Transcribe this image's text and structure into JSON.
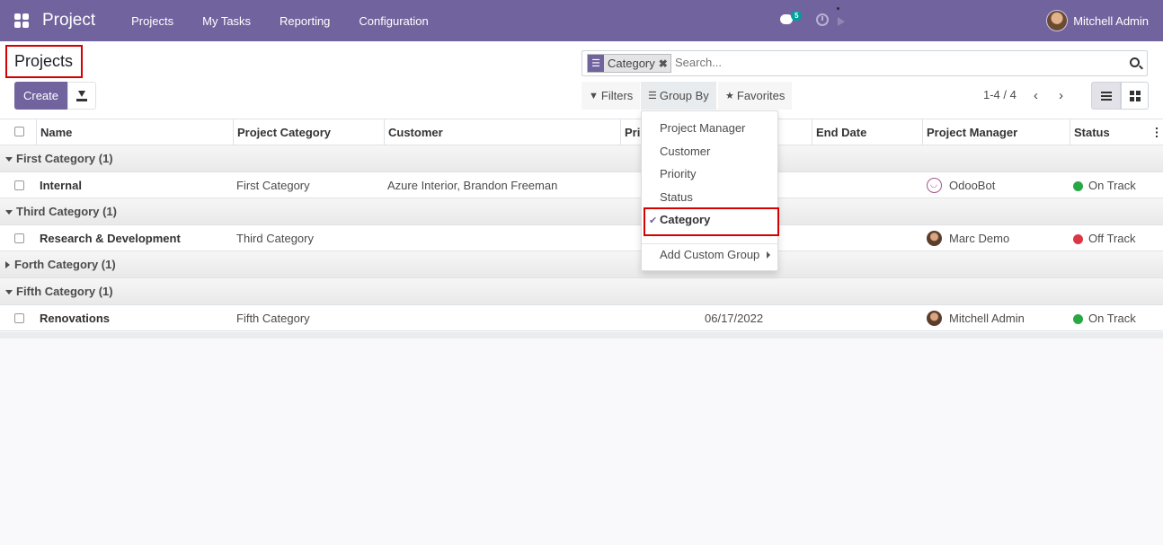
{
  "navbar": {
    "app_title": "Project",
    "menu": [
      "Projects",
      "My Tasks",
      "Reporting",
      "Configuration"
    ],
    "chat_badge": "5",
    "user_name": "Mitchell Admin"
  },
  "control": {
    "breadcrumb_title": "Projects",
    "create_label": "Create",
    "search": {
      "facet_label": "Category",
      "placeholder": "Search..."
    },
    "filters_label": "Filters",
    "groupby_label": "Group By",
    "favorites_label": "Favorites",
    "pager": "1-4 / 4"
  },
  "table": {
    "headers": [
      "Name",
      "Project Category",
      "Customer",
      "Pri",
      "End Date",
      "Project Manager",
      "Status"
    ],
    "groups": [
      {
        "label": "First Category (1)",
        "expanded": true
      },
      {
        "label": "Third Category (1)",
        "expanded": true
      },
      {
        "label": "Forth Category (1)",
        "expanded": false
      },
      {
        "label": "Fifth Category (1)",
        "expanded": true
      }
    ],
    "rows": [
      {
        "name": "Internal",
        "category": "First Category",
        "customer": "Azure Interior, Brandon Freeman",
        "date": "",
        "manager": "OdooBot",
        "status": "On Track",
        "status_color": "#28a745"
      },
      {
        "name": "Research & Development",
        "category": "Third Category",
        "customer": "",
        "date": "",
        "manager": "Marc Demo",
        "status": "Off Track",
        "status_color": "#dc3545"
      },
      {
        "name": "Renovations",
        "category": "Fifth Category",
        "customer": "",
        "date": "06/17/2022",
        "manager": "Mitchell Admin",
        "status": "On Track",
        "status_color": "#28a745"
      }
    ]
  },
  "groupby_menu": {
    "items": [
      "Project Manager",
      "Customer",
      "Priority",
      "Status",
      "Category"
    ],
    "selected": "Category",
    "custom_group": "Add Custom Group"
  },
  "colors": {
    "brand": "#71639e",
    "highlight_border": "#d50000"
  }
}
